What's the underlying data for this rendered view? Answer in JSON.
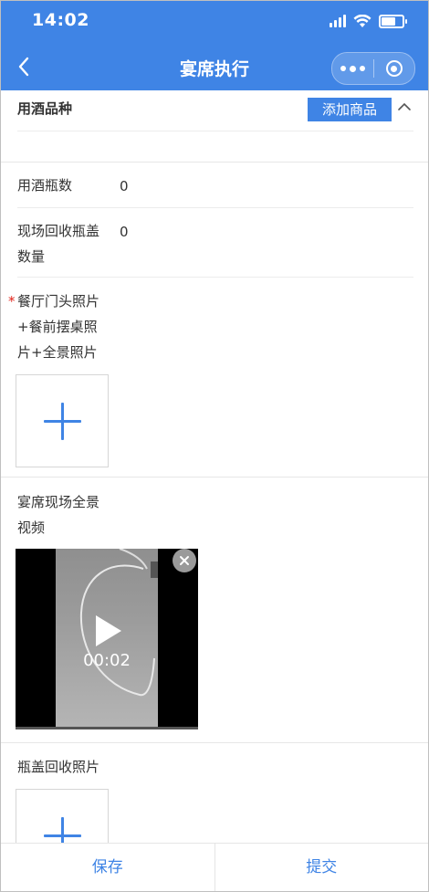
{
  "status_bar": {
    "time": "14:02"
  },
  "header": {
    "title": "宴席执行"
  },
  "wine_variety": {
    "label": "用酒品种",
    "add_button": "添加商品"
  },
  "bottle_count": {
    "label": "用酒瓶数",
    "value": "0"
  },
  "cap_recycle": {
    "label_line1": "现场回收瓶盖",
    "label_line2": "数量",
    "value": "0"
  },
  "photos": {
    "required_mark": "*",
    "label_line1": "餐厅门头照片",
    "label_line2": "+餐前摆桌照",
    "label_line3": "片+全景照片"
  },
  "video_section": {
    "label_line1": "宴席现场全景",
    "label_line2": "视频",
    "duration": "00:02"
  },
  "cap_photos": {
    "label": "瓶盖回收照片"
  },
  "footer": {
    "save": "保存",
    "submit": "提交"
  },
  "colors": {
    "primary": "#3f84e5",
    "required": "#e2231a"
  }
}
